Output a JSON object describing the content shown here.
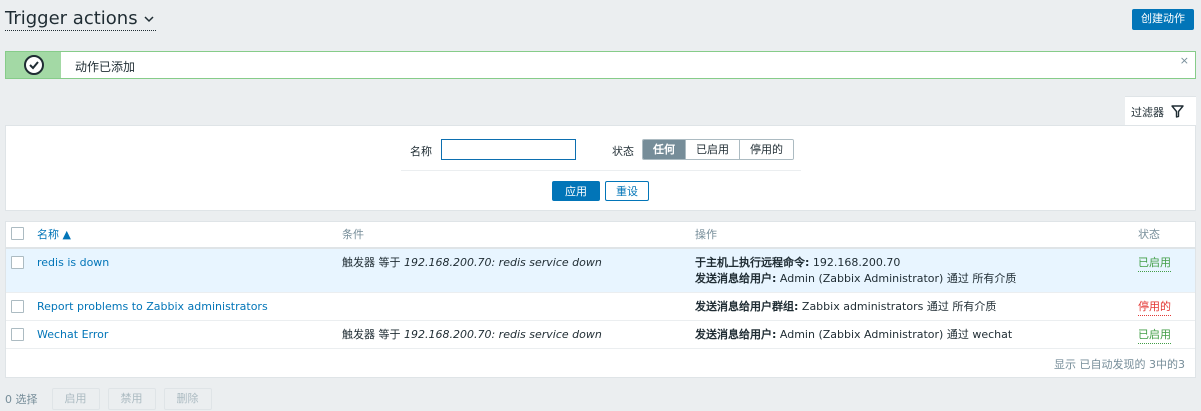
{
  "header": {
    "title": "Trigger actions",
    "create_label": "创建动作"
  },
  "message": {
    "text": "动作已添加",
    "close": "×"
  },
  "filter": {
    "tab_label": "过滤器",
    "name_label": "名称",
    "name_value": "",
    "status_label": "状态",
    "status_options": [
      "任何",
      "已启用",
      "停用的"
    ],
    "status_selected": "任何",
    "apply_label": "应用",
    "reset_label": "重设"
  },
  "table": {
    "headers": {
      "name": "名称 ▲",
      "conditions": "条件",
      "operations": "操作",
      "status": "状态"
    },
    "rows": [
      {
        "name": "redis is down",
        "cond_prefix": "触发器 等于",
        "cond_value": "192.168.200.70: redis service down",
        "op1_bold": "于主机上执行远程命令:",
        "op1_text": "192.168.200.70",
        "op2_bold": "发送消息给用户:",
        "op2_text": "Admin (Zabbix Administrator) 通过 所有介质",
        "status": "已启用"
      },
      {
        "name": "Report problems to Zabbix administrators",
        "cond_prefix": "",
        "cond_value": "",
        "op1_bold": "发送消息给用户群组:",
        "op1_text": "Zabbix administrators 通过 所有介质",
        "status": "停用的"
      },
      {
        "name": "Wechat Error",
        "cond_prefix": "触发器 等于",
        "cond_value": "192.168.200.70: redis service down",
        "op1_bold": "发送消息给用户:",
        "op1_text": "Admin (Zabbix Administrator) 通过 wechat",
        "status": "已启用"
      }
    ],
    "summary": "显示 已自动发现的 3中的3"
  },
  "footer": {
    "selected": "0 选择",
    "enable": "启用",
    "disable": "禁用",
    "delete": "删除"
  }
}
